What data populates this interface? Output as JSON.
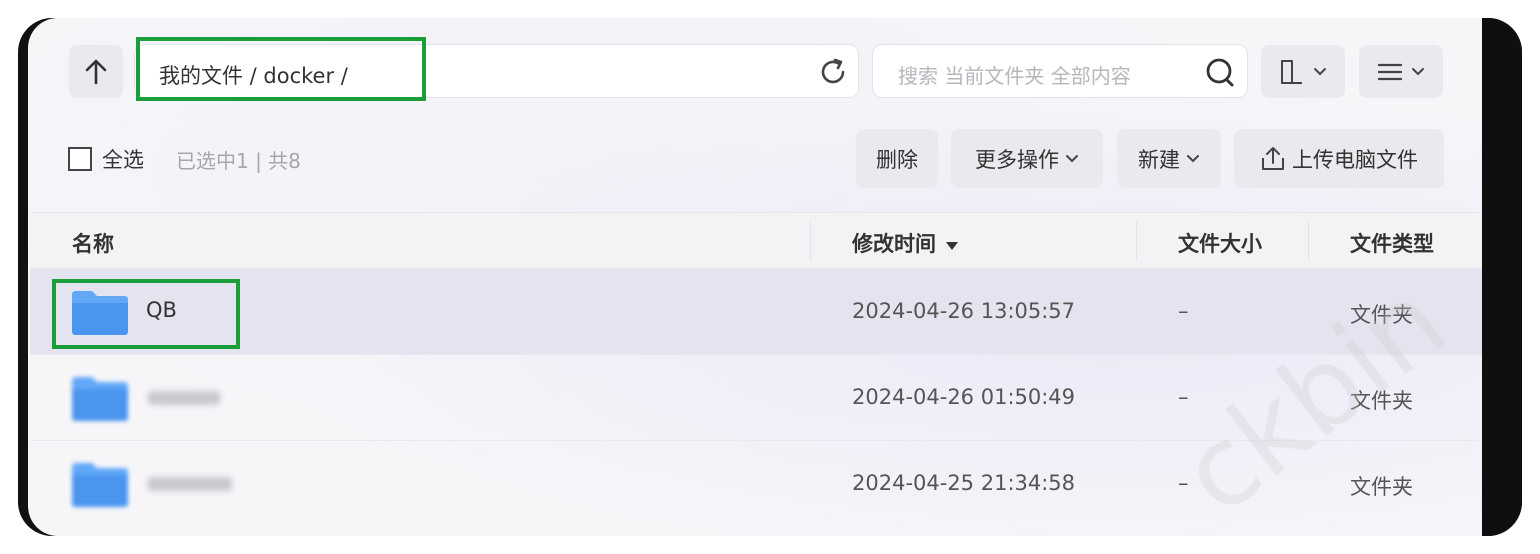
{
  "path": {
    "text": "我的文件 / docker /"
  },
  "search": {
    "placeholder": "搜索 当前文件夹 全部内容"
  },
  "selection": {
    "select_all": "全选",
    "count_text": "已选中1 | 共8"
  },
  "actions": {
    "delete": "删除",
    "more": "更多操作",
    "new": "新建",
    "upload": "上传电脑文件"
  },
  "columns": {
    "name": "名称",
    "modified": "修改时间",
    "size": "文件大小",
    "type": "文件类型"
  },
  "rows": [
    {
      "name": "QB",
      "modified": "2024-04-26 13:05:57",
      "size": "–",
      "type": "文件夹",
      "selected": true
    },
    {
      "name": "",
      "modified": "2024-04-26 01:50:49",
      "size": "–",
      "type": "文件夹",
      "selected": false
    },
    {
      "name": "",
      "modified": "2024-04-25 21:34:58",
      "size": "–",
      "type": "文件夹",
      "selected": false
    }
  ],
  "watermark": "ckbin",
  "icons": [
    "arrow-up-icon",
    "refresh-icon",
    "search-icon",
    "view-mode-icon",
    "list-menu-icon",
    "chevron-down-icon",
    "upload-icon",
    "folder-icon",
    "sort-desc-icon"
  ],
  "colors": {
    "highlight": "#1a9e3a",
    "folder": "#4a9af5",
    "selected_row": "#e3e4ef"
  }
}
